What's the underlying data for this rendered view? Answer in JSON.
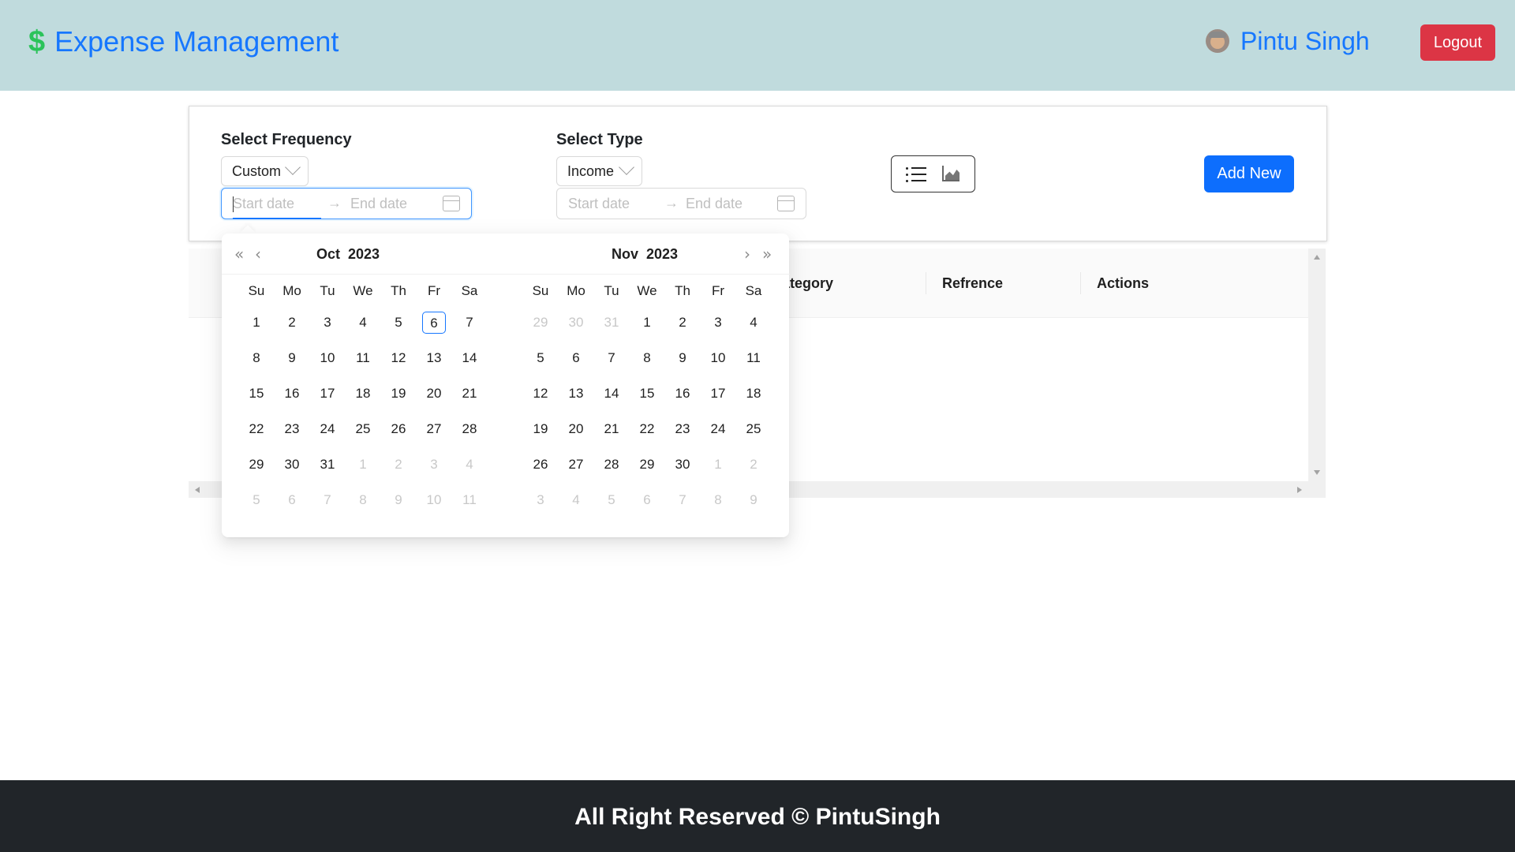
{
  "header": {
    "brand_icon": "dollar-icon",
    "brand_title": "Expense Management",
    "user_name": "Pintu Singh",
    "logout_label": "Logout"
  },
  "filters": {
    "frequency_label": "Select Frequency",
    "frequency_value": "Custom",
    "type_label": "Select Type",
    "type_value": "Income",
    "range_start_placeholder": "Start date",
    "range_end_placeholder": "End date",
    "range_separator": "→",
    "add_new_label": "Add New"
  },
  "view_toggle": {
    "list_icon": "list-icon",
    "chart_icon": "area-chart-icon"
  },
  "table": {
    "columns_visible": [
      "ategory",
      "Refrence",
      "Actions"
    ]
  },
  "calendar": {
    "weekdays": [
      "Su",
      "Mo",
      "Tu",
      "We",
      "Th",
      "Fr",
      "Sa"
    ],
    "panels": [
      {
        "month": "Oct",
        "year": "2023",
        "nav": [
          "«",
          "‹"
        ],
        "days": [
          [
            "1",
            "2",
            "3",
            "4",
            "5",
            "6",
            "7"
          ],
          [
            "8",
            "9",
            "10",
            "11",
            "12",
            "13",
            "14"
          ],
          [
            "15",
            "16",
            "17",
            "18",
            "19",
            "20",
            "21"
          ],
          [
            "22",
            "23",
            "24",
            "25",
            "26",
            "27",
            "28"
          ],
          [
            "29",
            "30",
            "31",
            "1",
            "2",
            "3",
            "4"
          ],
          [
            "5",
            "6",
            "7",
            "8",
            "9",
            "10",
            "11"
          ]
        ],
        "out_of_month": [
          [],
          [],
          [],
          [],
          [
            3,
            4,
            5,
            6
          ],
          [
            0,
            1,
            2,
            3,
            4,
            5,
            6
          ]
        ],
        "today": [
          0,
          5
        ]
      },
      {
        "month": "Nov",
        "year": "2023",
        "nav": [
          "›",
          "»"
        ],
        "days": [
          [
            "29",
            "30",
            "31",
            "1",
            "2",
            "3",
            "4"
          ],
          [
            "5",
            "6",
            "7",
            "8",
            "9",
            "10",
            "11"
          ],
          [
            "12",
            "13",
            "14",
            "15",
            "16",
            "17",
            "18"
          ],
          [
            "19",
            "20",
            "21",
            "22",
            "23",
            "24",
            "25"
          ],
          [
            "26",
            "27",
            "28",
            "29",
            "30",
            "1",
            "2"
          ],
          [
            "3",
            "4",
            "5",
            "6",
            "7",
            "8",
            "9"
          ]
        ],
        "out_of_month": [
          [
            0,
            1,
            2
          ],
          [],
          [],
          [],
          [
            5,
            6
          ],
          [
            0,
            1,
            2,
            3,
            4,
            5,
            6
          ]
        ]
      }
    ]
  },
  "footer": {
    "text": "All Right Reserved © PintuSingh"
  },
  "colors": {
    "navbar_bg": "#c0dbdd",
    "brand_blue": "#1677ff",
    "dollar_green": "#2bc35a",
    "logout_red": "#dc3545",
    "primary_button": "#0d6efd",
    "footer_bg": "#212529"
  }
}
